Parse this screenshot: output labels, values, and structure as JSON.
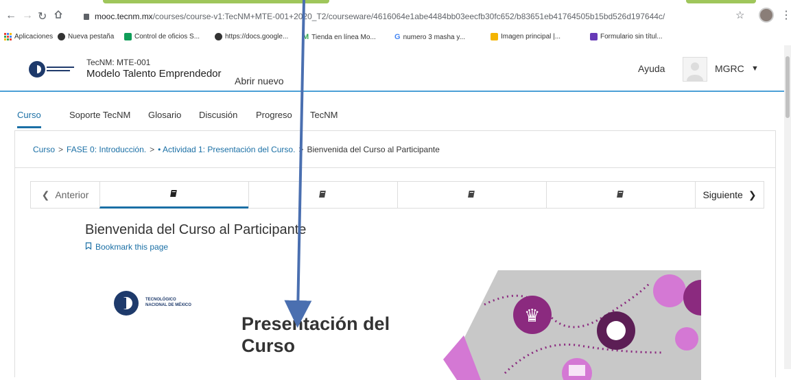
{
  "browser": {
    "url_host": "mooc.tecnm.mx",
    "url_path": "/courses/course-v1:TecNM+MTE-001+2020_T2/courseware/4616064e1abe4484bb03eecfb30fc652/b83651eb41764505b15bd526d197644c/",
    "nav_icons": [
      "back-icon",
      "forward-icon",
      "reload-icon",
      "home-icon",
      "lock-icon",
      "star-icon"
    ],
    "bookmarks": [
      {
        "label": "Aplicaciones",
        "icon": "apps-grid-icon",
        "color": "#ea4335"
      },
      {
        "label": "Nueva pestaña",
        "icon": "globe-icon",
        "color": "#333333"
      },
      {
        "label": "Control de oficios S...",
        "icon": "sheet-icon",
        "color": "#0f9d58"
      },
      {
        "label": "https://docs.google...",
        "icon": "globe-icon",
        "color": "#333333"
      },
      {
        "label": "Tienda en línea Mo...",
        "icon": "m-logo-icon",
        "color": "#34a853"
      },
      {
        "label": "numero 3 masha y...",
        "icon": "google-icon",
        "color": "#4285f4"
      },
      {
        "label": "Imagen principal |...",
        "icon": "image-icon",
        "color": "#f4b400"
      },
      {
        "label": "Formulario sin títul...",
        "icon": "form-icon",
        "color": "#673ab7"
      }
    ]
  },
  "header": {
    "org": "TecNM: MTE-001",
    "course_name": "Modelo Talento Emprendedor",
    "abrir_label": "Abrir nuevo",
    "help_label": "Ayuda",
    "username": "MGRC",
    "accent": "#4b9fd6"
  },
  "course_nav": {
    "tabs": [
      {
        "label": "Curso",
        "active": true
      },
      {
        "label": "Soporte TecNM",
        "active": false
      },
      {
        "label": "Glosario",
        "active": false
      },
      {
        "label": "Discusión",
        "active": false
      },
      {
        "label": "Progreso",
        "active": false
      },
      {
        "label": "TecNM",
        "active": false
      }
    ]
  },
  "breadcrumb": {
    "items": [
      "Curso",
      "FASE 0: Introducción.",
      "• Actividad 1: Presentación del Curso.",
      "Bienvenida del Curso al Participante"
    ],
    "separator": ">"
  },
  "unit_nav": {
    "prev_label": "Anterior",
    "next_label": "Siguiente",
    "sequence_icons": [
      "book-icon",
      "book-icon",
      "book-icon",
      "book-icon"
    ],
    "active_index": 0
  },
  "unit": {
    "title": "Bienvenida del Curso al Participante",
    "bookmark_label": "Bookmark this page",
    "banner_title_line1": "Presentación del",
    "banner_title_line2": "Curso",
    "logo_text_line1": "TECNOLÓGICO",
    "logo_text_line2": "NACIONAL DE MÉXICO"
  },
  "colors": {
    "link": "#1a6fa5",
    "banner_purple": "#8b2a7f",
    "banner_pink": "#d478d4",
    "banner_gray": "#c8c8c8",
    "arrow": "#4a6fb0"
  }
}
